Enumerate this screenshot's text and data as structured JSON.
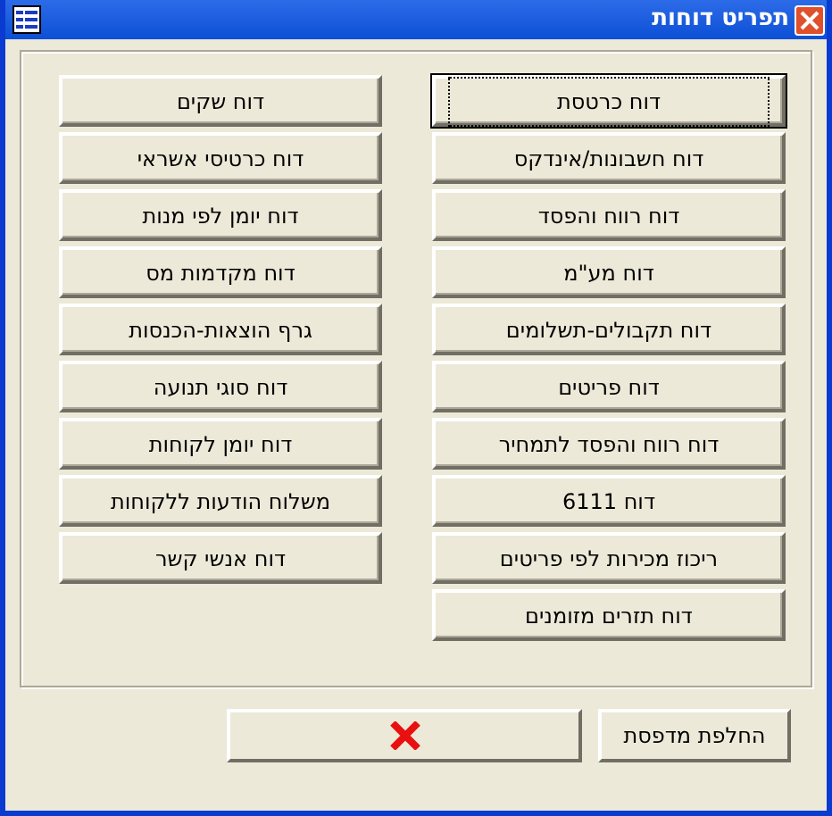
{
  "window": {
    "title": "תפריט דוחות"
  },
  "right_column": [
    {
      "label": "דוח כרטסת",
      "focused": true
    },
    {
      "label": "דוח חשבונות/אינדקס",
      "focused": false
    },
    {
      "label": "דוח רווח והפסד",
      "focused": false
    },
    {
      "label": "דוח מע\"מ",
      "focused": false
    },
    {
      "label": "דוח תקבולים-תשלומים",
      "focused": false
    },
    {
      "label": "דוח פריטים",
      "focused": false
    },
    {
      "label": "דוח רווח והפסד לתמחיר",
      "focused": false
    },
    {
      "label": "דוח 6111",
      "focused": false
    },
    {
      "label": "ריכוז מכירות לפי פריטים",
      "focused": false
    },
    {
      "label": "דוח תזרים מזומנים",
      "focused": false
    }
  ],
  "left_column": [
    {
      "label": "דוח שקים",
      "focused": false
    },
    {
      "label": "דוח כרטיסי אשראי",
      "focused": false
    },
    {
      "label": "דוח יומן לפי מנות",
      "focused": false
    },
    {
      "label": "דוח מקדמות מס",
      "focused": false
    },
    {
      "label": "גרף הוצאות-הכנסות",
      "focused": false
    },
    {
      "label": "דוח סוגי תנועה",
      "focused": false
    },
    {
      "label": "דוח יומן לקוחות",
      "focused": false
    },
    {
      "label": "משלוח הודעות ללקוחות",
      "focused": false
    },
    {
      "label": "דוח אנשי קשר",
      "focused": false
    }
  ],
  "footer": {
    "printer_button": "החלפת מדפסת"
  }
}
